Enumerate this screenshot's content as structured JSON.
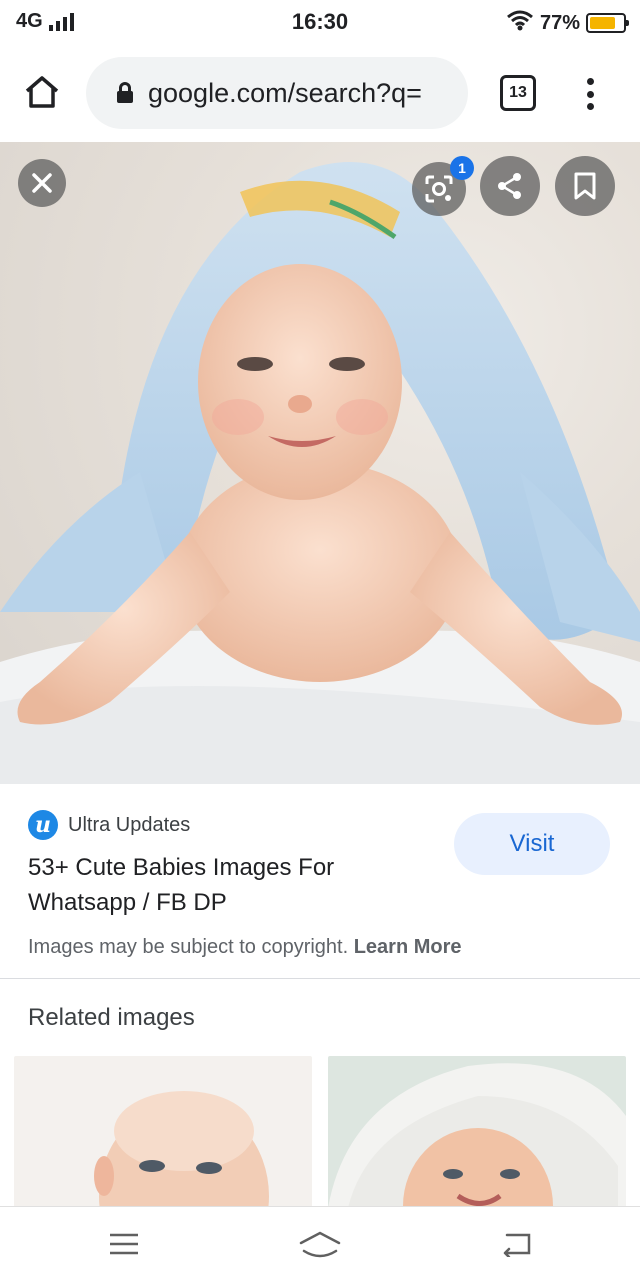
{
  "status_bar": {
    "network": "4G",
    "time": "16:30",
    "battery_percent": "77%",
    "battery_level": 0.77,
    "battery_color": "#f5b400"
  },
  "browser": {
    "url": "google.com/search?q=",
    "tab_count": "13",
    "icons": {
      "home": "home-icon",
      "lock": "lock-icon",
      "menu": "more-vert-icon"
    }
  },
  "image_viewer": {
    "lens_badge": "1",
    "icons": [
      "close-icon",
      "lens-icon",
      "share-icon",
      "bookmark-icon"
    ]
  },
  "result": {
    "source_logo_letter": "u",
    "source_name": "Ultra Updates",
    "title": "53+ Cute Babies Images For Whatsapp / FB DP",
    "visit_label": "Visit",
    "copyright_text": "Images may be subject to copyright.",
    "learn_more": "Learn More",
    "accent_color": "#1967d2"
  },
  "related": {
    "heading": "Related images"
  },
  "nav_bar": {
    "icons": [
      "menu-icon",
      "home-nav-icon",
      "back-icon"
    ]
  }
}
